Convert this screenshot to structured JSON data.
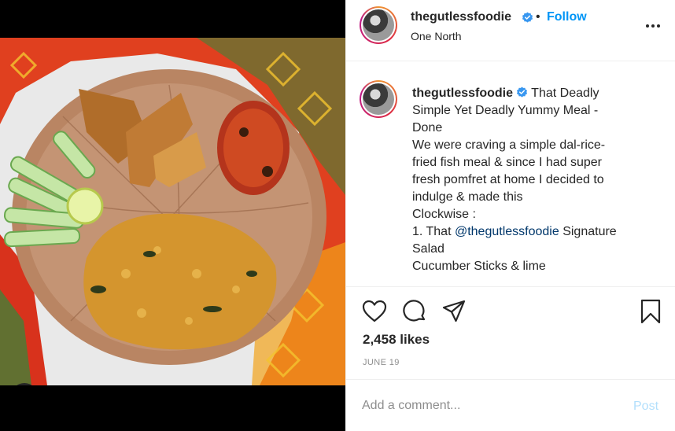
{
  "post": {
    "username": "thegutlessfoodie",
    "follow_label": "Follow",
    "follow_separator": "•",
    "location": "One North",
    "caption": {
      "username": "thegutlessfoodie",
      "lines": [
        "That Deadly",
        "Simple Yet Deadly Yummy Meal -",
        "Done",
        "We were craving a simple dal-rice-",
        "fried fish meal & since I had super",
        "fresh pomfret at home I decided to",
        "indulge & made this",
        "Clockwise :",
        "1. That ",
        "Salad",
        "Cucumber Sticks & lime"
      ],
      "mention": "@thegutlessfoodie",
      "mention_suffix": " Signature"
    },
    "likes": "2,458 likes",
    "date": "JUNE 19",
    "comment_placeholder": "Add a comment...",
    "post_label": "Post"
  },
  "icons": {
    "verified": "verified-badge-icon",
    "more": "more-options-icon",
    "like": "heart-icon",
    "comment": "comment-icon",
    "share": "share-icon",
    "save": "bookmark-icon",
    "tag": "user-tag-icon"
  },
  "colors": {
    "accent": "#0095f6",
    "post_disabled": "#b2dffc",
    "muted": "#8e8e8e",
    "mention": "#00376b"
  }
}
